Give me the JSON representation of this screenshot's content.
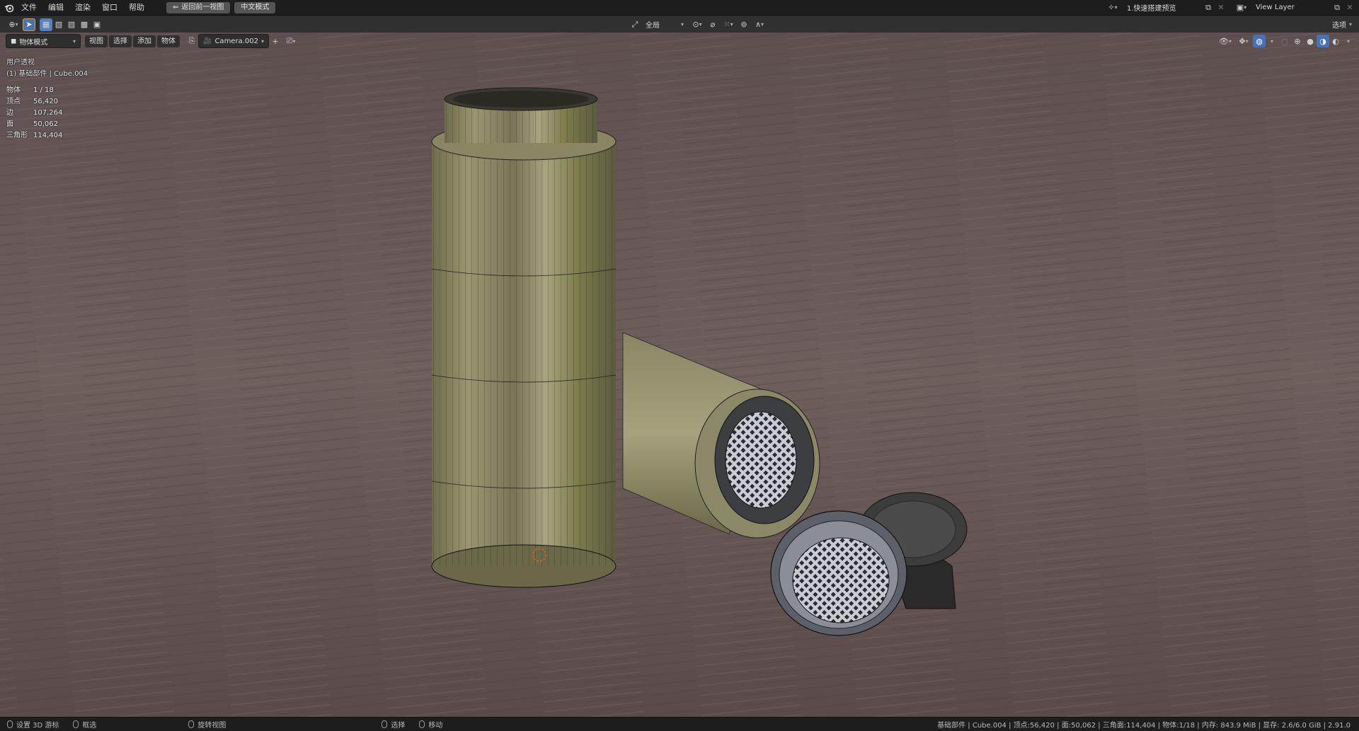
{
  "menu": {
    "items": [
      "文件",
      "编辑",
      "渲染",
      "窗口",
      "帮助"
    ],
    "back_button": "返回前一视图",
    "lang_button": "中文模式"
  },
  "scene": {
    "name": "1.快速搭建预览",
    "view_layer": "View Layer"
  },
  "toolbar": {
    "transform_orientation": "全局",
    "options_label": "选项"
  },
  "header": {
    "mode": "物体模式",
    "menus": [
      "视图",
      "选择",
      "添加",
      "物体"
    ],
    "camera": "Camera.002"
  },
  "viewport": {
    "view_name": "用户透视",
    "object_info": "(1) 基础部件 | Cube.004",
    "stats": [
      {
        "label": "物体",
        "value": "1 / 18"
      },
      {
        "label": "顶点",
        "value": "56,420"
      },
      {
        "label": "边",
        "value": "107,264"
      },
      {
        "label": "面",
        "value": "50,062"
      },
      {
        "label": "三角形",
        "value": "114,404"
      }
    ]
  },
  "status": {
    "left": [
      "设置 3D 游标",
      "框选",
      "旋转视图",
      "选择",
      "移动"
    ],
    "right": "基础部件 | Cube.004 | 顶点:56,420 | 面:50,062 | 三角面:114,404 | 物体:1/18 | 内存: 843.9 MiB | 显存: 2.6/6.0 GiB | 2.91.0"
  },
  "colors": {
    "accent": "#4772b3",
    "floor": "#6e5e5c",
    "bottle": "#8a8760"
  }
}
